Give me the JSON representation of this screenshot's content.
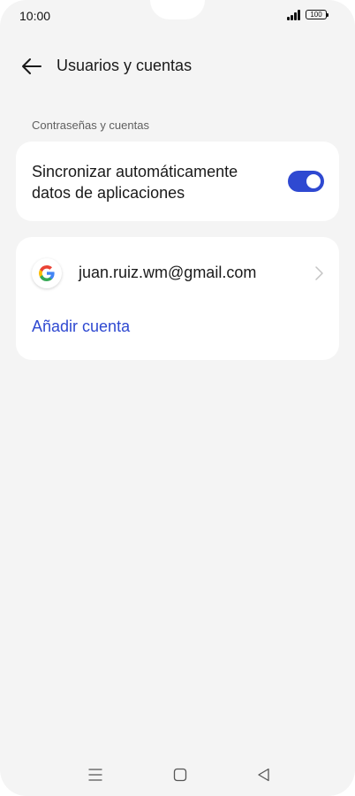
{
  "status_bar": {
    "time": "10:00",
    "battery": "100",
    "signal_icon": "signal-bars-icon",
    "battery_icon": "battery-icon"
  },
  "header": {
    "title": "Usuarios y cuentas",
    "back_icon": "arrow-left-icon"
  },
  "section": {
    "label": "Contraseñas y cuentas"
  },
  "sync": {
    "label": "Sincronizar automáticamente datos de aplicaciones",
    "enabled": true
  },
  "accounts": {
    "items": [
      {
        "email": "juan.ruiz.wm@gmail.com",
        "provider_icon": "google-logo-icon"
      }
    ],
    "add_label": "Añadir cuenta"
  },
  "nav": {
    "menu_icon": "menu-icon",
    "home_icon": "square-home-icon",
    "back_icon": "triangle-back-icon"
  },
  "colors": {
    "accent": "#2f49d1",
    "background": "#f4f4f4",
    "card": "#ffffff"
  }
}
